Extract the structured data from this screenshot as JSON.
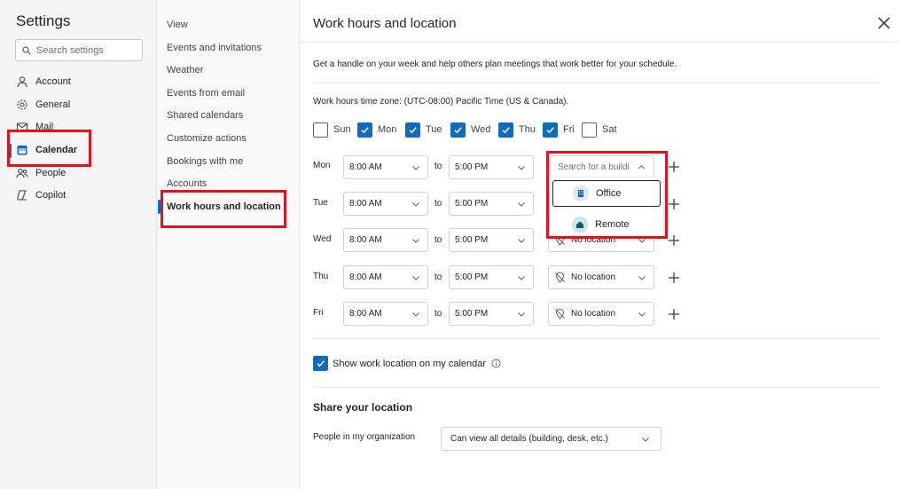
{
  "settings": {
    "title": "Settings",
    "search_placeholder": "Search settings",
    "nav": [
      {
        "label": "Account",
        "icon": "person-icon"
      },
      {
        "label": "General",
        "icon": "gear-icon"
      },
      {
        "label": "Mail",
        "icon": "mail-icon"
      },
      {
        "label": "Calendar",
        "icon": "calendar-icon",
        "active": true
      },
      {
        "label": "People",
        "icon": "people-icon"
      },
      {
        "label": "Copilot",
        "icon": "copilot-icon"
      }
    ]
  },
  "calendar_nav": [
    "View",
    "Events and invitations",
    "Weather",
    "Events from email",
    "Shared calendars",
    "Customize actions",
    "Bookings with me",
    "Accounts",
    "Work hours and location"
  ],
  "page": {
    "title": "Work hours and location",
    "intro": "Get a handle on your week and help others plan meetings that work better for your schedule.",
    "timezone": "Work hours time zone: (UTC-08:00) Pacific Time (US & Canada).",
    "days": [
      {
        "label": "Sun",
        "checked": false
      },
      {
        "label": "Mon",
        "checked": true
      },
      {
        "label": "Tue",
        "checked": true
      },
      {
        "label": "Wed",
        "checked": true
      },
      {
        "label": "Thu",
        "checked": true
      },
      {
        "label": "Fri",
        "checked": true
      },
      {
        "label": "Sat",
        "checked": false
      }
    ],
    "to_label": "to",
    "rows": [
      {
        "day": "Mon",
        "start": "8:00 AM",
        "end": "5:00 PM",
        "location": ""
      },
      {
        "day": "Tue",
        "start": "8:00 AM",
        "end": "5:00 PM",
        "location": ""
      },
      {
        "day": "Wed",
        "start": "8:00 AM",
        "end": "5:00 PM",
        "location": "No location"
      },
      {
        "day": "Thu",
        "start": "8:00 AM",
        "end": "5:00 PM",
        "location": "No location"
      },
      {
        "day": "Fri",
        "start": "8:00 AM",
        "end": "5:00 PM",
        "location": "No location"
      }
    ],
    "building_search_placeholder": "Search for a buildi",
    "location_options": [
      {
        "label": "Office",
        "icon": "building-icon",
        "selected": true
      },
      {
        "label": "Remote",
        "icon": "home-icon",
        "selected": false
      }
    ],
    "show_location_label": "Show work location on my calendar",
    "show_location_checked": true,
    "share_heading": "Share your location",
    "people_label": "People in my organization",
    "people_value": "Can view all details (building, desk, etc.)"
  },
  "colors": {
    "accent": "#0f6cbd",
    "annotation": "#e0121d"
  }
}
